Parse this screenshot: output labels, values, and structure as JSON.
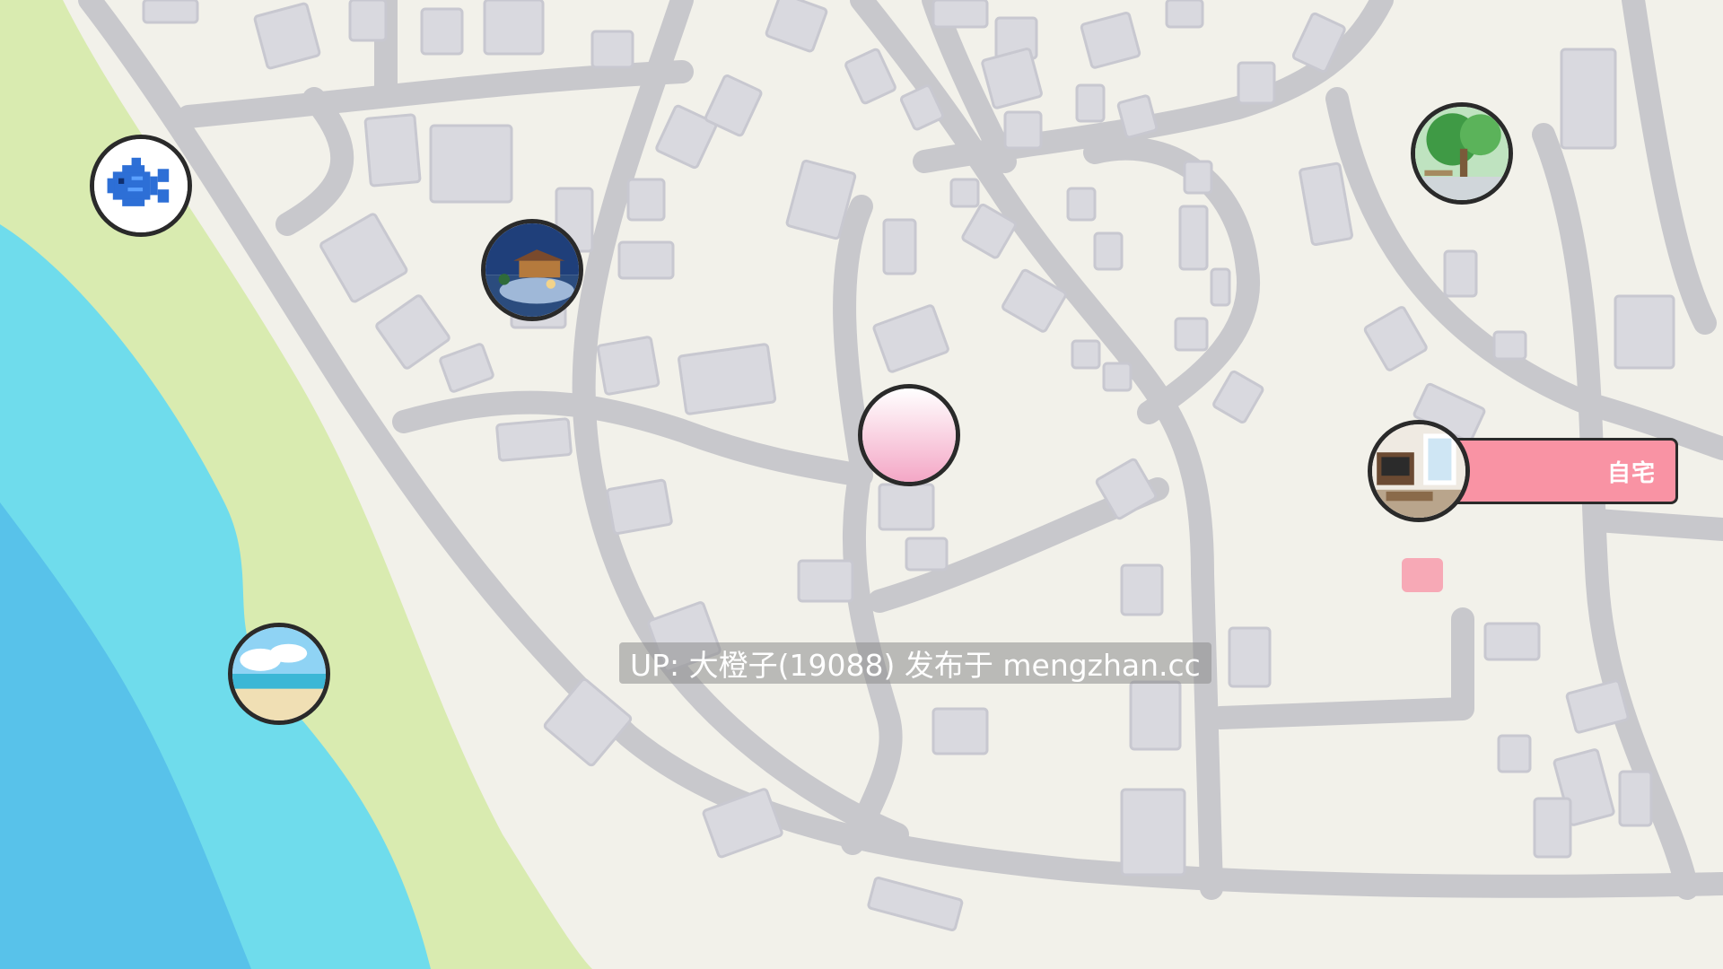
{
  "map": {
    "colors": {
      "land": "#f2f1ea",
      "road": "#c8c8cc",
      "building": "#d9d9df",
      "beach": "#d9ebb0",
      "sea_shallow": "#6fdcec",
      "sea_deep": "#58c2ea",
      "home_pin": "#f7a9b6"
    }
  },
  "markers": [
    {
      "name": "fishing-spot",
      "icon": "fish-icon"
    },
    {
      "name": "hot-spring",
      "icon": "hot-spring-thumbnail"
    },
    {
      "name": "park",
      "icon": "park-thumbnail"
    },
    {
      "name": "beach",
      "icon": "beach-thumbnail"
    },
    {
      "name": "player-location",
      "icon": "pink-circle"
    },
    {
      "name": "home",
      "icon": "home-interior-thumbnail"
    }
  ],
  "home": {
    "label": "自宅",
    "color": "#f993a4"
  },
  "watermark": {
    "text": "UP: 大橙子(19088) 发布于 mengzhan.cc"
  }
}
